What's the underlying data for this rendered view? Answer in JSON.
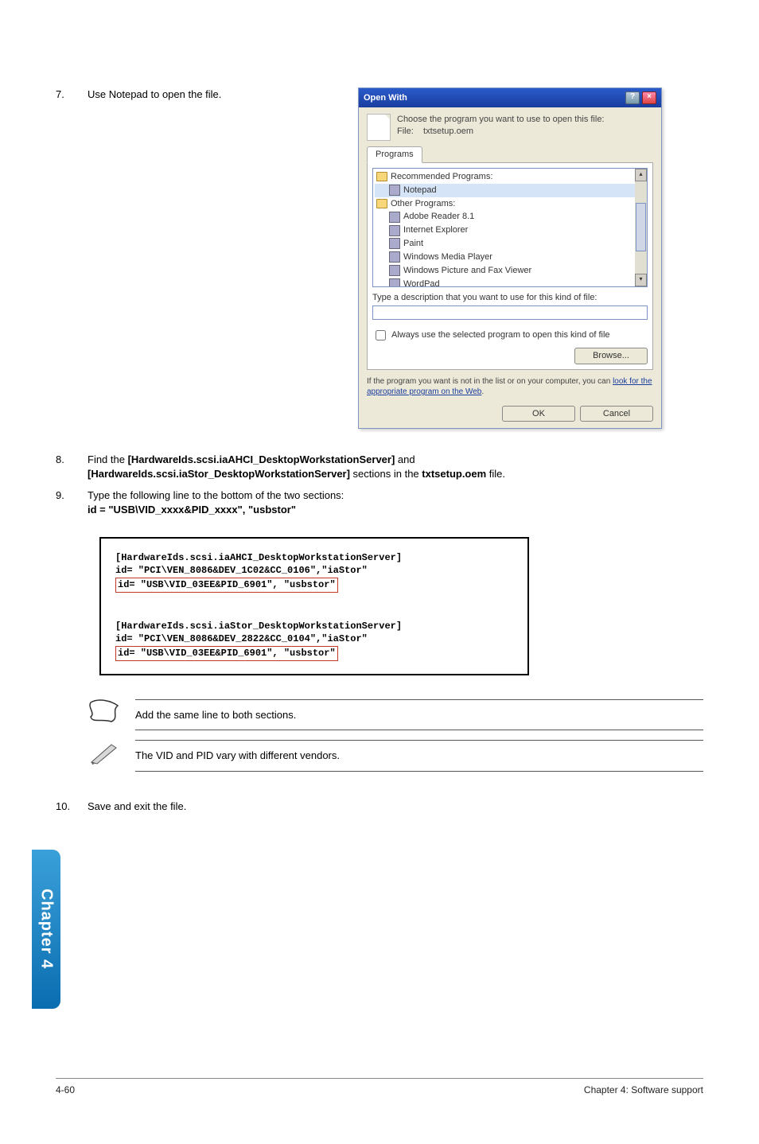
{
  "steps": {
    "7": {
      "num": "7.",
      "text": "Use Notepad to open the file."
    },
    "8": {
      "num": "8.",
      "lead": "Find the ",
      "b1": "[HardwareIds.scsi.iaAHCI_DesktopWorkstationServer]",
      "mid": " and ",
      "b2": "[HardwareIds.scsi.iaStor_DesktopWorkstationServer]",
      "trail": " sections in the ",
      "fname": "txtsetup.oem",
      "end": " file."
    },
    "9": {
      "num": "9.",
      "line1": "Type the following line to the bottom of the two sections:",
      "line2": "id = \"USB\\VID_xxxx&PID_xxxx\", \"usbstor\""
    },
    "10": {
      "num": "10.",
      "text": "Save and exit the file."
    }
  },
  "dialog": {
    "title": "Open With",
    "topline": "Choose the program you want to use to open this file:",
    "file_label": "File:",
    "file_name": "txtsetup.oem",
    "tab": "Programs",
    "recommended_header": "Recommended Programs:",
    "rec_item": "Notepad",
    "other_header": "Other Programs:",
    "others": [
      "Adobe Reader 8.1",
      "Internet Explorer",
      "Paint",
      "Windows Media Player",
      "Windows Picture and Fax Viewer",
      "WordPad"
    ],
    "desc_label": "Type a description that you want to use for this kind of file:",
    "check_label": "Always use the selected program to open this kind of file",
    "browse": "Browse...",
    "footnote_lead": "If the program you want is not in the list or on your computer, you can ",
    "footnote_link": "look for the appropriate program on the Web",
    "footnote_end": ".",
    "ok": "OK",
    "cancel": "Cancel"
  },
  "code": {
    "a1": "[HardwareIds.scsi.iaAHCI_DesktopWorkstationServer]",
    "a2": "id= \"PCI\\VEN_8086&DEV_1C02&CC_0106\",\"iaStor\"",
    "a3": "id= \"USB\\VID_03EE&PID_6901\", \"usbstor\"",
    "b1": "[HardwareIds.scsi.iaStor_DesktopWorkstationServer]",
    "b2": "id= \"PCI\\VEN_8086&DEV_2822&CC_0104\",\"iaStor\"",
    "b3": "id= \"USB\\VID_03EE&PID_6901\", \"usbstor\""
  },
  "notes": {
    "n1": "Add the same line to both sections.",
    "n2": "The VID and PID vary with different vendors."
  },
  "chapter_tab": "Chapter 4",
  "footer": {
    "left": "4-60",
    "right": "Chapter 4: Software support"
  }
}
